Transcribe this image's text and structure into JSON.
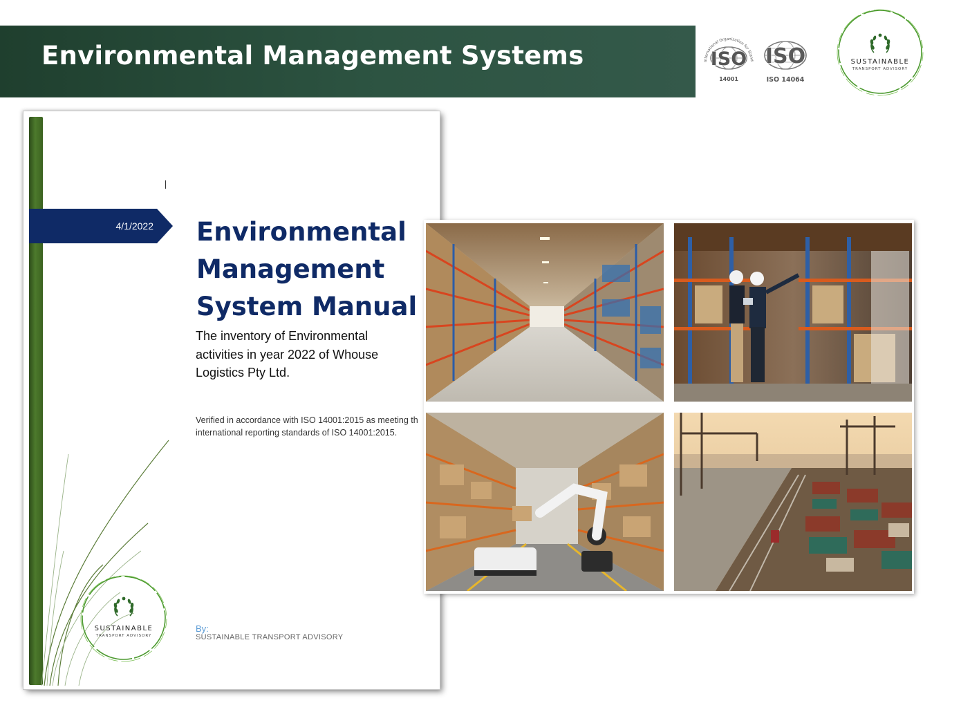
{
  "header": {
    "title": "Environmental Management Systems"
  },
  "logos": {
    "iso_a": {
      "mark": "ISO",
      "caption": "14001",
      "ring_text": "International Organization for Standardization"
    },
    "iso_b": {
      "mark": "ISO",
      "caption": "ISO 14064"
    },
    "brand": {
      "name": "SUSTAINABLE",
      "tagline": "TRANSPORT ADVISORY"
    }
  },
  "document": {
    "date": "4/1/2022",
    "title_lines": [
      "Environmental",
      "Management",
      "System Manual"
    ],
    "subtitle_lines": [
      "The inventory of Environmental",
      "activities in year 2022 of Whouse",
      "Logistics Pty Ltd."
    ],
    "verification_lines": [
      "Verified in accordance with ISO 14001:2015 as meeting th",
      "international reporting standards of ISO 14001:2015."
    ],
    "by_label": "By:",
    "by_name": "SUSTAINABLE TRANSPORT ADVISORY",
    "brand": {
      "name": "SUSTAINABLE",
      "tagline": "TRANSPORT ADVISORY"
    }
  },
  "photos": [
    {
      "icon": "warehouse-aisle-photo"
    },
    {
      "icon": "warehouse-inspectors-photo"
    },
    {
      "icon": "warehouse-robot-photo"
    },
    {
      "icon": "container-port-photo"
    }
  ],
  "colors": {
    "banner": "#2d5442",
    "title_navy": "#0f2a66",
    "date_tag": "#0f2a66",
    "doc_bar": "#4d7a2c",
    "link_blue": "#5b9bd5",
    "brand_green": "#3e8e2a"
  }
}
